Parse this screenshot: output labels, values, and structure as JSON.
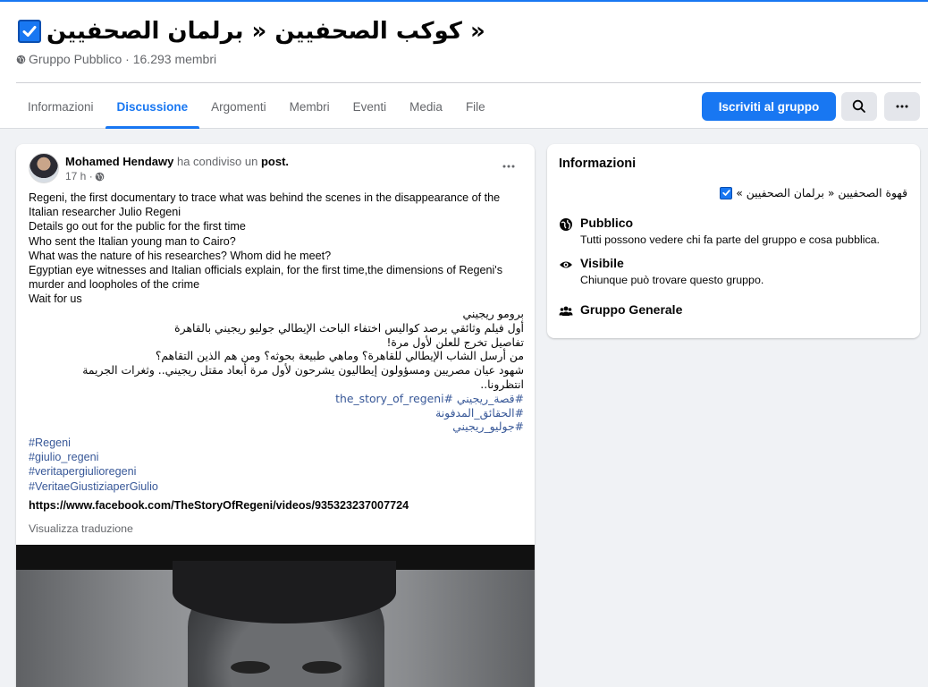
{
  "header": {
    "group_name": "كوكب الصحفيين « برلمان الصحفيين »",
    "meta": "Gruppo Pubblico · 16.293 membri"
  },
  "tabs": [
    {
      "label": "Informazioni"
    },
    {
      "label": "Discussione"
    },
    {
      "label": "Argomenti"
    },
    {
      "label": "Membri"
    },
    {
      "label": "Eventi"
    },
    {
      "label": "Media"
    },
    {
      "label": "File"
    }
  ],
  "actions": {
    "join_label": "Iscriviti al gruppo",
    "search_icon": "search-icon",
    "more_icon": "more-icon"
  },
  "post": {
    "author": "Mohamed Hendawy",
    "shared_text": "ha condiviso un",
    "post_word": "post.",
    "time": "17 h ·",
    "english_lines": [
      "Regeni, the first documentary to trace what was behind the scenes in the disappearance of the",
      "Italian researcher Julio Regeni",
      "Details go out for the public for the first time",
      "Who sent the Italian young man to Cairo?",
      "What was the nature of his researches? Whom did he meet?",
      "Egyptian eye witnesses and Italian officials explain, for the first time,the dimensions of Regeni's",
      "murder and loopholes of the crime",
      "Wait for us"
    ],
    "arabic_lines": [
      "برومو ريجيني",
      "أول فيلم وثائقي يرصد كواليس اختفاء الباحث الإيطالي جوليو ريجيني بالقاهرة",
      "تفاصيل تخرج للعلن لأول مرة!",
      "من أرسل الشاب الإيطالي للقاهرة؟ وماهي طبيعة بحوثه؟ ومن هم الذين التقاهم؟",
      "شهود عيان مصريين ومسؤولون إيطاليون يشرحون لأول مرة أبعاد مقتل ريجيني.. وثغرات الجريمة",
      "انتظرونا.."
    ],
    "arabic_tags": [
      "#قصة_ريجيني #the_story_of_regeni",
      "#الحقائق_المدفونة",
      "#جوليو_ريجيني"
    ],
    "hashtags": [
      " #Regeni",
      " #giulio_regeni",
      "#veritapergiulioregeni",
      "#VeritaeGiustiziaperGiulio"
    ],
    "link": "https://www.facebook.com/TheStoryOfRegeni/videos/935323237007724",
    "translate": "Visualizza traduzione"
  },
  "info": {
    "title": "Informazioni",
    "description": "قهوة الصحفيين « برلمان الصحفيين »",
    "rows": [
      {
        "label": "Pubblico",
        "sub": "Tutti possono vedere chi fa parte del gruppo e cosa pubblica.",
        "icon": "globe-icon"
      },
      {
        "label": "Visibile",
        "sub": "Chiunque può trovare questo gruppo.",
        "icon": "eye-icon"
      },
      {
        "label": "Gruppo Generale",
        "sub": "",
        "icon": "people-icon"
      }
    ]
  },
  "colors": {
    "accent": "#1877f2",
    "link": "#385898",
    "muted": "#65676b",
    "background": "#f0f2f5"
  }
}
